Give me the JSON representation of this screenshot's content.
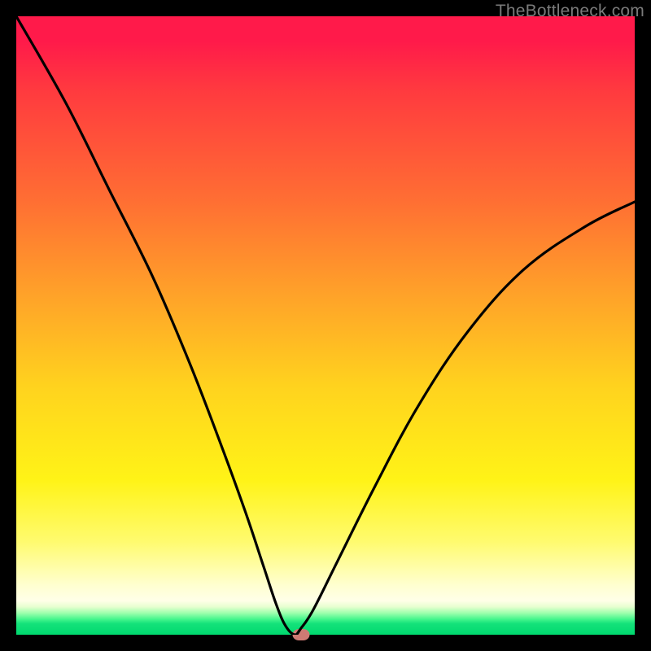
{
  "watermark": "TheBottleneck.com",
  "colors": {
    "background": "#000000",
    "curve_stroke": "#000000",
    "marker_fill": "#cf7a74"
  },
  "chart_data": {
    "type": "line",
    "title": "",
    "xlabel": "",
    "ylabel": "",
    "xlim": [
      0,
      100
    ],
    "ylim": [
      0,
      100
    ],
    "grid": false,
    "series": [
      {
        "name": "bottleneck-curve",
        "x": [
          0,
          8,
          15,
          22,
          28,
          33,
          37,
          40,
          42,
          43.5,
          45,
          46,
          48,
          52,
          58,
          65,
          73,
          82,
          92,
          100
        ],
        "values": [
          100,
          86,
          72,
          58,
          44,
          31,
          20,
          11,
          5,
          1.5,
          0,
          1,
          4,
          12,
          24,
          37,
          49,
          59,
          66,
          70
        ]
      }
    ],
    "annotations": [
      {
        "type": "marker",
        "x": 46,
        "y": 0,
        "label": "optimal-point"
      }
    ]
  }
}
